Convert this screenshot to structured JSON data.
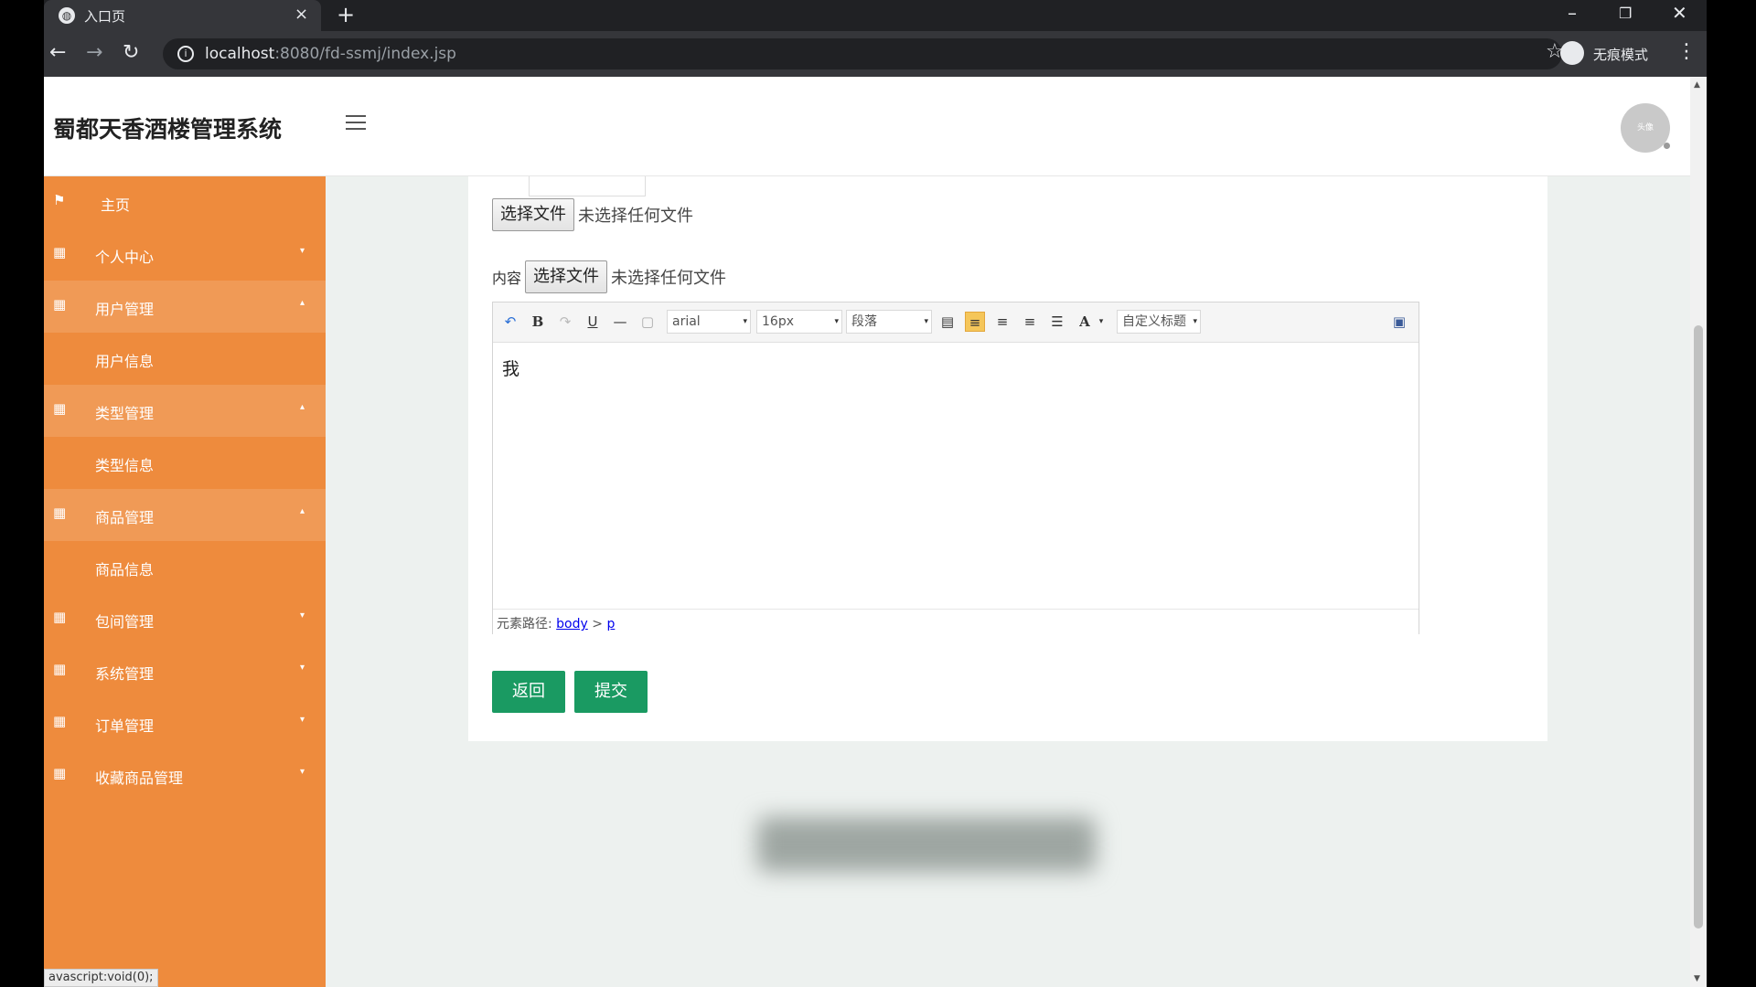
{
  "browser": {
    "tab_title": "入口页",
    "tab_close": "×",
    "new_tab": "+",
    "url_host": "localhost",
    "url_rest": ":8080/fd-ssmj/index.jsp",
    "incognito_label": "无痕模式",
    "minimize": "–",
    "restore": "❐",
    "close": "✕"
  },
  "header": {
    "site_title": "蜀都天香酒楼管理系统",
    "avatar_text": "头像"
  },
  "sidebar": {
    "items": [
      {
        "label": "主页",
        "icon": "flag-icon"
      },
      {
        "label": "个人中心",
        "icon": "grid-icon"
      },
      {
        "label": "用户管理",
        "icon": "grid-icon"
      },
      {
        "label": "用户信息",
        "icon": ""
      },
      {
        "label": "类型管理",
        "icon": "grid-icon"
      },
      {
        "label": "类型信息",
        "icon": ""
      },
      {
        "label": "商品管理",
        "icon": "grid-icon"
      },
      {
        "label": "商品信息",
        "icon": ""
      },
      {
        "label": "包间管理",
        "icon": "grid-icon"
      },
      {
        "label": "系统管理",
        "icon": "grid-icon"
      },
      {
        "label": "订单管理",
        "icon": "grid-icon"
      },
      {
        "label": "收藏商品管理",
        "icon": "grid-icon"
      }
    ]
  },
  "form": {
    "file1": {
      "button": "选择文件",
      "status": "未选择任何文件"
    },
    "file2": {
      "label": "内容",
      "button": "选择文件",
      "status": "未选择任何文件"
    },
    "editor": {
      "font_family": "arial",
      "font_size": "16px",
      "paragraph": "段落",
      "custom_title": "自定义标题",
      "content": "我",
      "path_label": "元素路径:",
      "path_body": "body",
      "path_sep": " > ",
      "path_p": "p"
    },
    "back_button": "返回",
    "submit_button": "提交"
  },
  "status_bar": {
    "text": "avascript:void(0);"
  }
}
